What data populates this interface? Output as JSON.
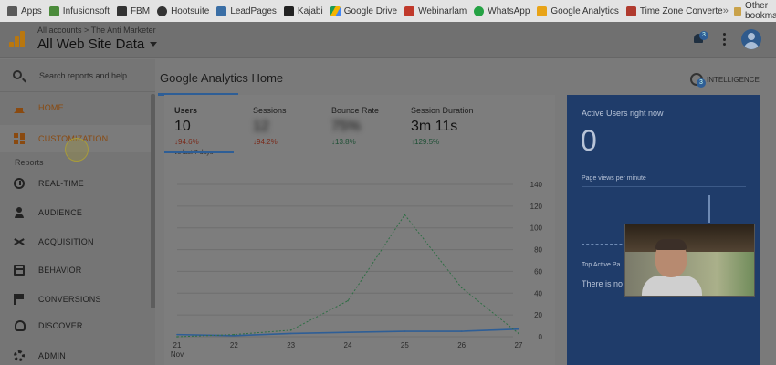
{
  "bookmarks": {
    "items": [
      {
        "label": "Apps",
        "icon": "apps-grid-icon",
        "color": "#5a5a5a"
      },
      {
        "label": "Infusionsoft",
        "icon": "infusionsoft-icon",
        "color": "#4b8b3b"
      },
      {
        "label": "FBM",
        "icon": "fbm-icon",
        "color": "#333333"
      },
      {
        "label": "Hootsuite",
        "icon": "hootsuite-owl-icon",
        "color": "#333333"
      },
      {
        "label": "LeadPages",
        "icon": "leadpages-icon",
        "color": "#3a6ea5"
      },
      {
        "label": "Kajabi",
        "icon": "kajabi-icon",
        "color": "#222222"
      },
      {
        "label": "Google Drive",
        "icon": "google-drive-icon",
        "color": "#e3a21a"
      },
      {
        "label": "Webinarlam",
        "icon": "webinarjam-icon",
        "color": "#c0392b"
      },
      {
        "label": "WhatsApp",
        "icon": "whatsapp-icon",
        "color": "#25a244"
      },
      {
        "label": "Google Analytics",
        "icon": "google-analytics-icon",
        "color": "#e8a317"
      },
      {
        "label": "Time Zone Converte",
        "icon": "time-zone-icon",
        "color": "#b03a2e"
      }
    ],
    "overflow": "»",
    "other": "Other bookmarks"
  },
  "header": {
    "breadcrumb": "All accounts > The Anti Marketer",
    "property": "All Web Site Data",
    "notification_count": "3",
    "accent_color": "#1a73e8"
  },
  "sidebar": {
    "search_placeholder": "Search reports and help",
    "items": [
      {
        "label": "HOME",
        "icon": "home-icon"
      },
      {
        "label": "CUSTOMIZATION",
        "icon": "customization-icon"
      },
      {
        "label": "REAL-TIME",
        "icon": "clock-icon"
      },
      {
        "label": "AUDIENCE",
        "icon": "person-icon"
      },
      {
        "label": "ACQUISITION",
        "icon": "acquisition-icon"
      },
      {
        "label": "BEHAVIOR",
        "icon": "behavior-icon"
      },
      {
        "label": "CONVERSIONS",
        "icon": "flag-icon"
      },
      {
        "label": "DISCOVER",
        "icon": "lightbulb-icon"
      },
      {
        "label": "ADMIN",
        "icon": "gear-icon"
      }
    ],
    "reports_label": "Reports"
  },
  "main": {
    "title": "Google Analytics Home",
    "intelligence": {
      "label": "INTELLIGENCE",
      "badge": "3"
    },
    "metrics": [
      {
        "label": "Users",
        "value": "10",
        "delta": "94.6%",
        "direction": "down",
        "sub": "vs last 7 days"
      },
      {
        "label": "Sessions",
        "value": "12",
        "delta": "94.2%",
        "direction": "down"
      },
      {
        "label": "Bounce Rate",
        "value": "75%",
        "delta": "13.8%",
        "direction": "up"
      },
      {
        "label": "Session Duration",
        "value": "3m 11s",
        "delta": "129.5%",
        "direction": "up"
      }
    ]
  },
  "chart_data": {
    "type": "line",
    "x": [
      "21 Nov",
      "22",
      "23",
      "24",
      "25",
      "26",
      "27"
    ],
    "ylim": [
      0,
      140
    ],
    "yticks": [
      0,
      20,
      40,
      60,
      80,
      100,
      120,
      140
    ],
    "series": [
      {
        "values": [
          2,
          1,
          3,
          4,
          5,
          5,
          7
        ],
        "style": "solid",
        "color": "#2e5e96"
      },
      {
        "values": [
          0,
          2,
          6,
          33,
          112,
          45,
          3
        ],
        "style": "dashed",
        "color": "#2e6e44"
      }
    ]
  },
  "active_users": {
    "title": "Active Users right now",
    "value": "0",
    "page_views_label": "Page views per minute",
    "top_pages_label": "Top Active Pa",
    "empty_text": "There is no"
  }
}
